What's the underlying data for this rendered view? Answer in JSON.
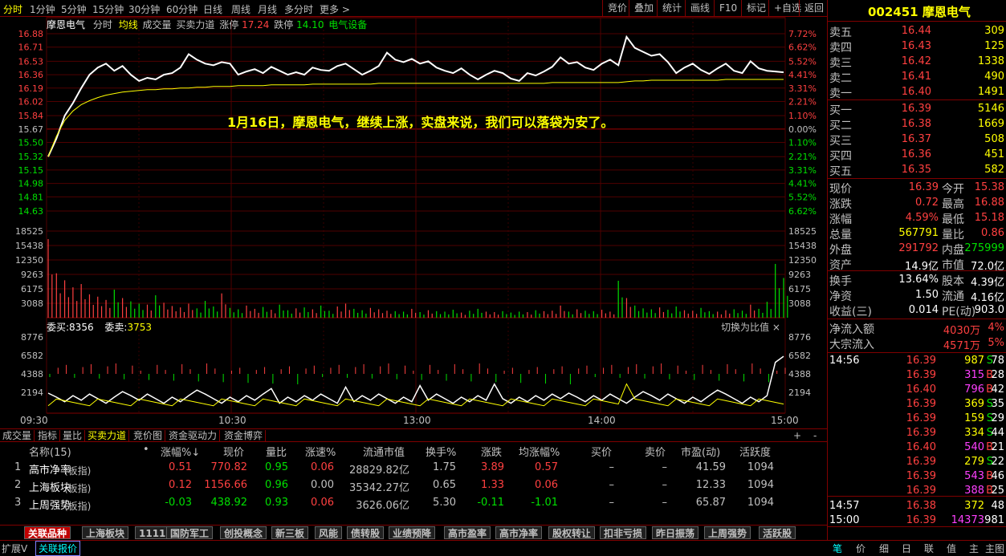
{
  "topbar": {
    "left": [
      "分时",
      "1分钟",
      "5分钟",
      "15分钟",
      "30分钟",
      "60分钟",
      "日线",
      "周线",
      "月线",
      "多分时",
      "更多 >"
    ],
    "right": [
      "竞价",
      "叠加",
      "统计",
      "画线",
      "F10",
      "标记",
      "+自选",
      "返回"
    ]
  },
  "chart_header": {
    "name": "摩恩电气",
    "mode": "分时",
    "ma": "均线",
    "vol": "成交量",
    "ind": "买卖力道",
    "zt_label": "涨停",
    "zt": "17.24",
    "dt_label": "跌停",
    "dt": "14.10",
    "industry": "电气设备"
  },
  "annotation": "1月16日，摩恩电气，继续上涨，实盘来说，我们可以落袋为安了。",
  "price_axis": [
    "16.88",
    "16.71",
    "16.53",
    "16.36",
    "16.19",
    "16.02",
    "15.84",
    "15.67",
    "15.50",
    "15.32",
    "15.15",
    "14.98",
    "14.81",
    "14.63"
  ],
  "pct_axis": [
    "7.72%",
    "6.62%",
    "5.52%",
    "4.41%",
    "3.31%",
    "2.21%",
    "1.10%",
    "0.00%",
    "1.10%",
    "2.21%",
    "3.31%",
    "4.41%",
    "5.52%",
    "6.62%"
  ],
  "vol_axis": [
    "18525",
    "15438",
    "12350",
    "9263",
    "6175",
    "3088"
  ],
  "ind_axis": [
    "8776",
    "6582",
    "4388",
    "2194"
  ],
  "time_axis": [
    "09:30",
    "10:30",
    "13:00",
    "14:00",
    "15:00"
  ],
  "weibuy_label": "委买:",
  "weibuy": "8356",
  "weisell_label": "委卖:",
  "weisell": "3753",
  "switch_label": "切换为比值 ×",
  "chart_data": {
    "type": "line",
    "title": "",
    "x_range": [
      "09:30",
      "15:00"
    ],
    "ylim": [
      14.63,
      16.88
    ],
    "prev_close": 15.67,
    "series": [
      {
        "name": "",
        "values": [
          15.32,
          15.55,
          15.84,
          16.0,
          16.19,
          16.36,
          16.45,
          16.5,
          16.41,
          16.47,
          16.36,
          16.28,
          16.32,
          16.3,
          16.36,
          16.38,
          16.45,
          16.62,
          16.55,
          16.5,
          16.48,
          16.52,
          16.5,
          16.36,
          16.4,
          16.43,
          16.38,
          16.46,
          16.41,
          16.36,
          16.39,
          16.36,
          16.45,
          16.42,
          16.41,
          16.47,
          16.5,
          16.43,
          16.36,
          16.41,
          16.47,
          16.64,
          16.55,
          16.52,
          16.56,
          16.5,
          16.53,
          16.45,
          16.41,
          16.38,
          16.44,
          16.36,
          16.3,
          16.36,
          16.41,
          16.38,
          16.31,
          16.28,
          16.38,
          16.35,
          16.4,
          16.46,
          16.58,
          16.5,
          16.52,
          16.45,
          16.42,
          16.5,
          16.55,
          16.48,
          16.84,
          16.7,
          16.65,
          16.6,
          16.62,
          16.52,
          16.38,
          16.45,
          16.5,
          16.42,
          16.37,
          16.44,
          16.5,
          16.41,
          16.38,
          16.53,
          16.44,
          16.41,
          16.4,
          16.39
        ]
      },
      {
        "name": "",
        "values": [
          15.32,
          15.58,
          15.78,
          15.9,
          15.98,
          16.03,
          16.07,
          16.1,
          16.12,
          16.14,
          16.15,
          16.16,
          16.17,
          16.17,
          16.18,
          16.18,
          16.19,
          16.19,
          16.2,
          16.2,
          16.21,
          16.21,
          16.21,
          16.22,
          16.22,
          16.22,
          16.22,
          16.23,
          16.23,
          16.23,
          16.23,
          16.23,
          16.24,
          16.24,
          16.24,
          16.24,
          16.24,
          16.24,
          16.24,
          16.24,
          16.25,
          16.25,
          16.25,
          16.25,
          16.25,
          16.25,
          16.25,
          16.25,
          16.25,
          16.25,
          16.25,
          16.25,
          16.25,
          16.25,
          16.25,
          16.25,
          16.25,
          16.25,
          16.25,
          16.25,
          16.25,
          16.26,
          16.26,
          16.26,
          16.26,
          16.26,
          16.26,
          16.26,
          16.26,
          16.26,
          16.27,
          16.28,
          16.28,
          16.29,
          16.29,
          16.29,
          16.29,
          16.29,
          16.29,
          16.29,
          16.29,
          16.29,
          16.3,
          16.3,
          16.3,
          16.3,
          16.3,
          16.3,
          16.3,
          16.3
        ]
      }
    ],
    "volume_max": 18525,
    "volume": [
      16800,
      9500,
      8000,
      6500,
      7200,
      5000,
      4500,
      3800,
      6000,
      4200,
      3500,
      3000,
      2800,
      4800,
      3200,
      2500,
      2200,
      3000,
      2000,
      3600,
      2400,
      5200,
      2100,
      1800,
      2600,
      1900,
      2300,
      1700,
      2800,
      1600,
      2000,
      2200,
      1800,
      2600,
      1500,
      2400,
      3000,
      1900,
      1600,
      2100,
      1800,
      1500,
      1400,
      1300,
      1900,
      1200,
      1600,
      1400,
      1300,
      1700,
      1100,
      1500,
      1900,
      1300,
      1200,
      1400,
      1100,
      1300,
      1200,
      1600,
      1400,
      1500,
      2600,
      1300,
      1800,
      1500,
      1400,
      1700,
      1300,
      7900,
      4200,
      2600,
      2000,
      1800,
      2200,
      1700,
      2400,
      1600,
      1500,
      2100,
      1400,
      1300,
      1600,
      1800,
      1500,
      2800,
      1900,
      3400,
      11500,
      8500
    ]
  },
  "tabs": [
    "成交量",
    "指标",
    "量比",
    "买卖力道",
    "竞价图",
    "资金驱动力",
    "资金博弈"
  ],
  "table": {
    "headers": [
      "名称(15)",
      "•",
      "涨幅%↓",
      "现价",
      "量比",
      "涨速%",
      "流通市值",
      "换手%",
      "涨跌",
      "均涨幅%",
      "买价",
      "卖价",
      "市盈(动)",
      "活跃度"
    ],
    "rows": [
      {
        "idx": "1",
        "name": "高市净率",
        "tag": "(板指)",
        "zf": "0.51",
        "xj": "770.82",
        "lb": "0.95",
        "zs": "0.06",
        "ltsz": "28829.82亿",
        "hs": "1.75",
        "zd": "3.89",
        "jzf": "0.57",
        "mj": "–",
        "mmj": "–",
        "syl": "41.59",
        "hyd": "1094"
      },
      {
        "idx": "2",
        "name": "上海板块",
        "tag": "(板指)",
        "zf": "0.12",
        "xj": "1156.66",
        "lb": "0.96",
        "zs": "0.00",
        "ltsz": "35342.27亿",
        "hs": "0.65",
        "zd": "1.33",
        "jzf": "0.06",
        "mj": "–",
        "mmj": "–",
        "syl": "12.33",
        "hyd": "1094"
      },
      {
        "idx": "3",
        "name": "上周强势",
        "tag": "(板指)",
        "zf": "-0.03",
        "xj": "438.92",
        "lb": "0.93",
        "zs": "0.06",
        "ltsz": "3626.06亿",
        "hs": "5.30",
        "zd": "-0.11",
        "jzf": "-1.01",
        "mj": "–",
        "mmj": "–",
        "syl": "65.87",
        "hyd": "1094"
      }
    ]
  },
  "bottom_tabs": [
    "关联品种",
    "上海板块",
    "1111",
    "国防军工",
    "创投概念",
    "新三板",
    "风能",
    "债转股",
    "业绩预降",
    "高市盈率",
    "高市净率",
    "股权转让",
    "扣非亏损",
    "昨日振荡",
    "上周强势",
    "活跃股"
  ],
  "status": [
    "扩展V",
    "关联报价"
  ],
  "right": {
    "code": "002451",
    "name": "摩恩电气",
    "asks": [
      {
        "l": "卖五",
        "p": "16.44",
        "v": "309"
      },
      {
        "l": "卖四",
        "p": "16.43",
        "v": "125"
      },
      {
        "l": "卖三",
        "p": "16.42",
        "v": "1338"
      },
      {
        "l": "卖二",
        "p": "16.41",
        "v": "490"
      },
      {
        "l": "卖一",
        "p": "16.40",
        "v": "1491"
      }
    ],
    "bids": [
      {
        "l": "买一",
        "p": "16.39",
        "v": "5146"
      },
      {
        "l": "买二",
        "p": "16.38",
        "v": "1669"
      },
      {
        "l": "买三",
        "p": "16.37",
        "v": "508"
      },
      {
        "l": "买四",
        "p": "16.36",
        "v": "451"
      },
      {
        "l": "买五",
        "p": "16.35",
        "v": "582"
      }
    ],
    "quote": [
      {
        "l1": "现价",
        "v1": "16.39",
        "l2": "今开",
        "v2": "15.38"
      },
      {
        "l1": "涨跌",
        "v1": "0.72",
        "l2": "最高",
        "v2": "16.88"
      },
      {
        "l1": "涨幅",
        "v1": "4.59%",
        "l2": "最低",
        "v2": "15.18"
      },
      {
        "l1": "总量",
        "v1": "567791",
        "l2": "量比",
        "v2": "0.86"
      },
      {
        "l1": "外盘",
        "v1": "291792",
        "l2": "内盘",
        "v2": "275999"
      },
      {
        "l1": "资产",
        "v1": "14.9亿",
        "l2": "市值",
        "v2": "72.0亿"
      }
    ],
    "quote2": [
      {
        "l1": "换手",
        "v1": "13.64%",
        "l2": "股本",
        "v2": "4.39亿"
      },
      {
        "l1": "净资",
        "v1": "1.50",
        "l2": "流通",
        "v2": "4.16亿"
      },
      {
        "l1": "收益(三)",
        "v1": "0.014",
        "l2": "PE(动)",
        "v2": "903.0"
      }
    ],
    "flows": [
      {
        "l": "净流入额",
        "v": "4030万",
        "p": "4%"
      },
      {
        "l": "大宗流入",
        "v": "4571万",
        "p": "5%"
      }
    ],
    "ticks": [
      {
        "t": "14:56",
        "p": "16.39",
        "v": "987",
        "d": "S",
        "n": "78"
      },
      {
        "t": "",
        "p": "16.39",
        "v": "315",
        "d": "B",
        "n": "28"
      },
      {
        "t": "",
        "p": "16.40",
        "v": "796",
        "d": "B",
        "n": "42"
      },
      {
        "t": "",
        "p": "16.39",
        "v": "369",
        "d": "S",
        "n": "35"
      },
      {
        "t": "",
        "p": "16.39",
        "v": "159",
        "d": "S",
        "n": "29"
      },
      {
        "t": "",
        "p": "16.39",
        "v": "334",
        "d": "S",
        "n": "44"
      },
      {
        "t": "",
        "p": "16.40",
        "v": "540",
        "d": "B",
        "n": "21"
      },
      {
        "t": "",
        "p": "16.39",
        "v": "279",
        "d": "S",
        "n": "22"
      },
      {
        "t": "",
        "p": "16.39",
        "v": "543",
        "d": "B",
        "n": "46"
      },
      {
        "t": "",
        "p": "16.39",
        "v": "388",
        "d": "B",
        "n": "25"
      },
      {
        "t": "14:57",
        "p": "16.38",
        "v": "372",
        "d": "",
        "n": "48"
      },
      {
        "t": "15:00",
        "p": "16.39",
        "v": "14373",
        "d": "",
        "n": "981"
      }
    ],
    "footer": [
      "笔",
      "价",
      "细",
      "日",
      "联",
      "值",
      "主",
      "主图"
    ]
  }
}
